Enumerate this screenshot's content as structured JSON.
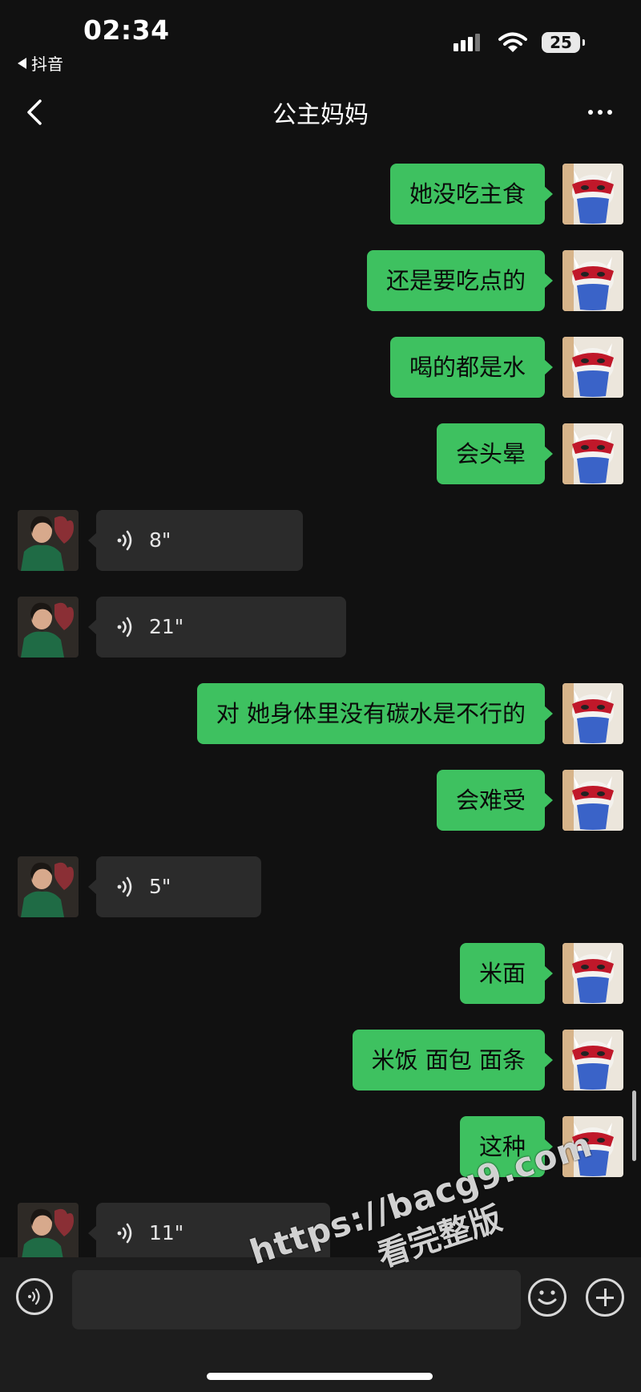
{
  "status_bar": {
    "time": "02:34",
    "back_app": "抖音",
    "battery": "25"
  },
  "nav": {
    "title": "公主妈妈"
  },
  "messages": [
    {
      "from": "me",
      "type": "text",
      "text": "她没吃主食"
    },
    {
      "from": "me",
      "type": "text",
      "text": "还是要吃点的"
    },
    {
      "from": "me",
      "type": "text",
      "text": "喝的都是水"
    },
    {
      "from": "me",
      "type": "text",
      "text": "会头晕"
    },
    {
      "from": "them",
      "type": "voice",
      "duration": "8\""
    },
    {
      "from": "them",
      "type": "voice",
      "duration": "21\""
    },
    {
      "from": "me",
      "type": "text",
      "text": "对 她身体里没有碳水是不行的"
    },
    {
      "from": "me",
      "type": "text",
      "text": "会难受"
    },
    {
      "from": "them",
      "type": "voice",
      "duration": "5\""
    },
    {
      "from": "me",
      "type": "text",
      "text": "米面"
    },
    {
      "from": "me",
      "type": "text",
      "text": "米饭 面包 面条"
    },
    {
      "from": "me",
      "type": "text",
      "text": "这种"
    },
    {
      "from": "them",
      "type": "voice",
      "duration": "11\""
    }
  ],
  "input": {
    "placeholder": ""
  },
  "watermark": {
    "url": "https://bacg9.com",
    "tag": "看完整版"
  },
  "colors": {
    "background": "#111111",
    "my_bubble": "#3ec160",
    "their_bubble": "#2b2b2b",
    "input_bar": "#1d1d1d"
  }
}
